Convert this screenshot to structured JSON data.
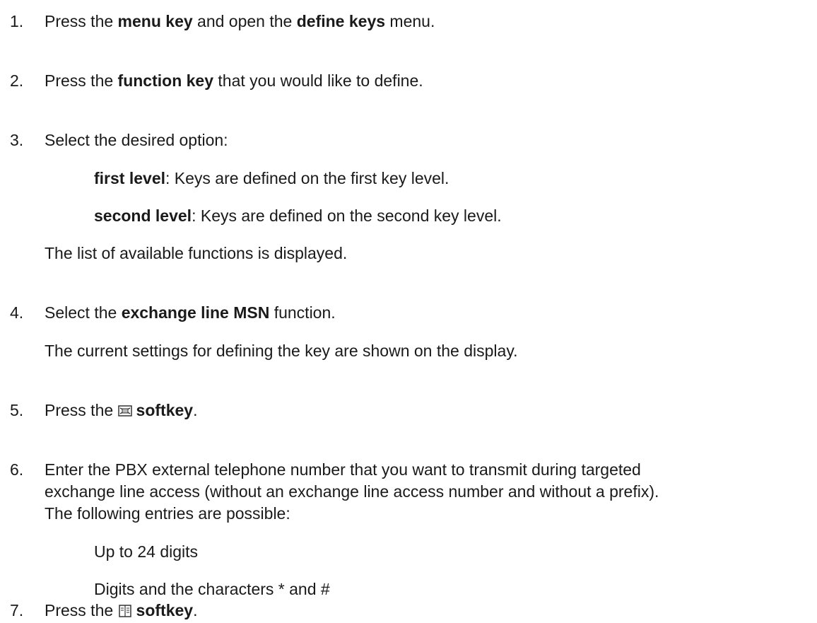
{
  "steps": [
    {
      "number": "1.",
      "pre": "Press the ",
      "b1": "menu key",
      "mid": " and open the ",
      "b2": "define keys",
      "post": " menu."
    },
    {
      "number": "2.",
      "pre": "Press the ",
      "b1": "function key",
      "post": " that you would like to define."
    },
    {
      "number": "3.",
      "text": "Select the desired option:",
      "options": [
        {
          "label": "first level",
          "text": ": Keys are defined on the first key level."
        },
        {
          "label": "second level",
          "text": ": Keys are defined on the second key level."
        }
      ],
      "note": "The list of available functions is displayed."
    },
    {
      "number": "4.",
      "pre": "Select the ",
      "b1": "exchange line MSN",
      "post": " function.",
      "note": "The current settings for defining the key are shown on the display."
    },
    {
      "number": "5.",
      "pre": "Press the ",
      "icon": "phone-book-edit-icon",
      "b1": "softkey",
      "post": "."
    },
    {
      "number": "6.",
      "lines": [
        "Enter the PBX external telephone number that you want to transmit during targeted",
        "exchange line access (without an exchange line access number and without a prefix).",
        "The following entries are possible:"
      ],
      "entries": [
        "Up to 24 digits",
        "Digits and the characters * and #"
      ]
    },
    {
      "number": "7.",
      "pre": "Press the ",
      "icon": "save-book-icon",
      "b1": "softkey",
      "post": "."
    }
  ]
}
